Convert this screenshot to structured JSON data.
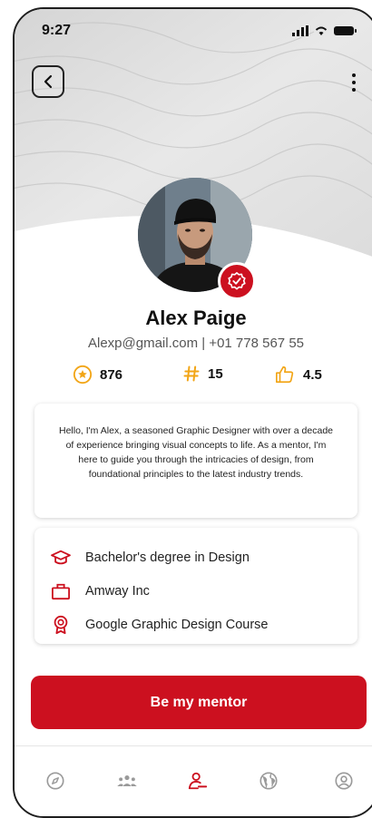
{
  "status_bar": {
    "time": "9:27"
  },
  "profile": {
    "name": "Alex Paige",
    "contact": "Alexp@gmail.com | +01 778 567 55",
    "stats": [
      {
        "icon": "star-circle-icon",
        "value": "876"
      },
      {
        "icon": "hashtag-icon",
        "value": "15"
      },
      {
        "icon": "thumbs-up-icon",
        "value": "4.5"
      }
    ],
    "bio": "Hello, I'm Alex, a seasoned Graphic Designer with over a decade of experience bringing visual concepts to life. As a mentor, I'm here to guide you through the intricacies of design, from foundational principles to the latest industry trends.",
    "details": [
      {
        "icon": "graduation-cap-icon",
        "label": "Bachelor's degree in Design"
      },
      {
        "icon": "briefcase-icon",
        "label": "Amway Inc"
      },
      {
        "icon": "award-ribbon-icon",
        "label": "Google Graphic Design Course"
      }
    ]
  },
  "cta": {
    "label": "Be my mentor"
  },
  "bottom_nav": [
    {
      "icon": "compass-icon",
      "active": false
    },
    {
      "icon": "group-icon",
      "active": false
    },
    {
      "icon": "mentor-icon",
      "active": true
    },
    {
      "icon": "globe-icon",
      "active": false
    },
    {
      "icon": "account-icon",
      "active": false
    }
  ],
  "colors": {
    "accent": "#cc101f",
    "star": "#f2a516",
    "inactive_icon": "#9a9a9a"
  }
}
